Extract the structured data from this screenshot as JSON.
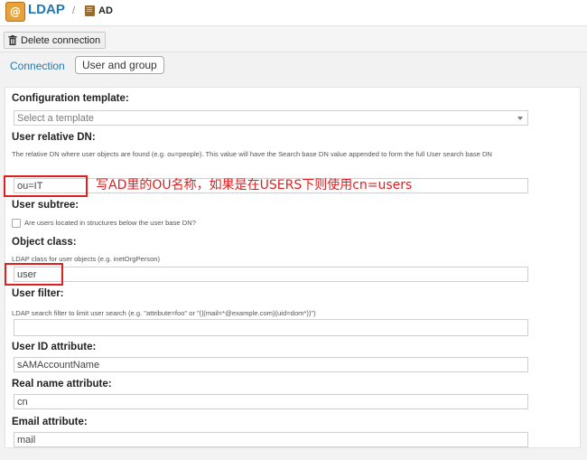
{
  "header": {
    "app_icon": "ldap-app-icon",
    "app_icon_glyph": "@",
    "app_title": "LDAP",
    "separator": "/",
    "breadcrumb_icon": "book-icon",
    "breadcrumb_label": "AD"
  },
  "toolbar": {
    "delete_icon": "trash-icon",
    "delete_label": "Delete connection"
  },
  "tabs": [
    {
      "label": "Connection"
    },
    {
      "label": "User and group"
    }
  ],
  "form": {
    "config_template": {
      "label": "Configuration template:",
      "placeholder": "Select a template"
    },
    "user_relative_dn": {
      "label": "User relative DN:",
      "help": "The relative DN where user objects are found (e.g. ou=people). This value will have the Search base DN value appended to form the full User search base DN",
      "value": "ou=IT"
    },
    "user_subtree": {
      "label": "User subtree:",
      "checkbox_label": "Are users located in structures below the user base DN?"
    },
    "object_class": {
      "label": "Object class:",
      "help": "LDAP class for user objects (e.g. inetOrgPerson)",
      "value": "user"
    },
    "user_filter": {
      "label": "User filter:",
      "help": "LDAP search filter to limit user search (e.g. \"attribute=foo\" or \"(|(mail=*@example.com)(uid=dom*))\")",
      "value": ""
    },
    "user_id_attribute": {
      "label": "User ID attribute:",
      "value": "sAMAccountName"
    },
    "real_name_attribute": {
      "label": "Real name attribute:",
      "value": "cn"
    },
    "email_attribute": {
      "label": "Email attribute:",
      "value": "mail"
    }
  },
  "annotation": {
    "text": "写AD里的OU名称，如果是在USERS下则使用cn=users",
    "color": "#e02020"
  },
  "colors": {
    "accent": "#1f78b4",
    "highlight": "#e02020"
  }
}
